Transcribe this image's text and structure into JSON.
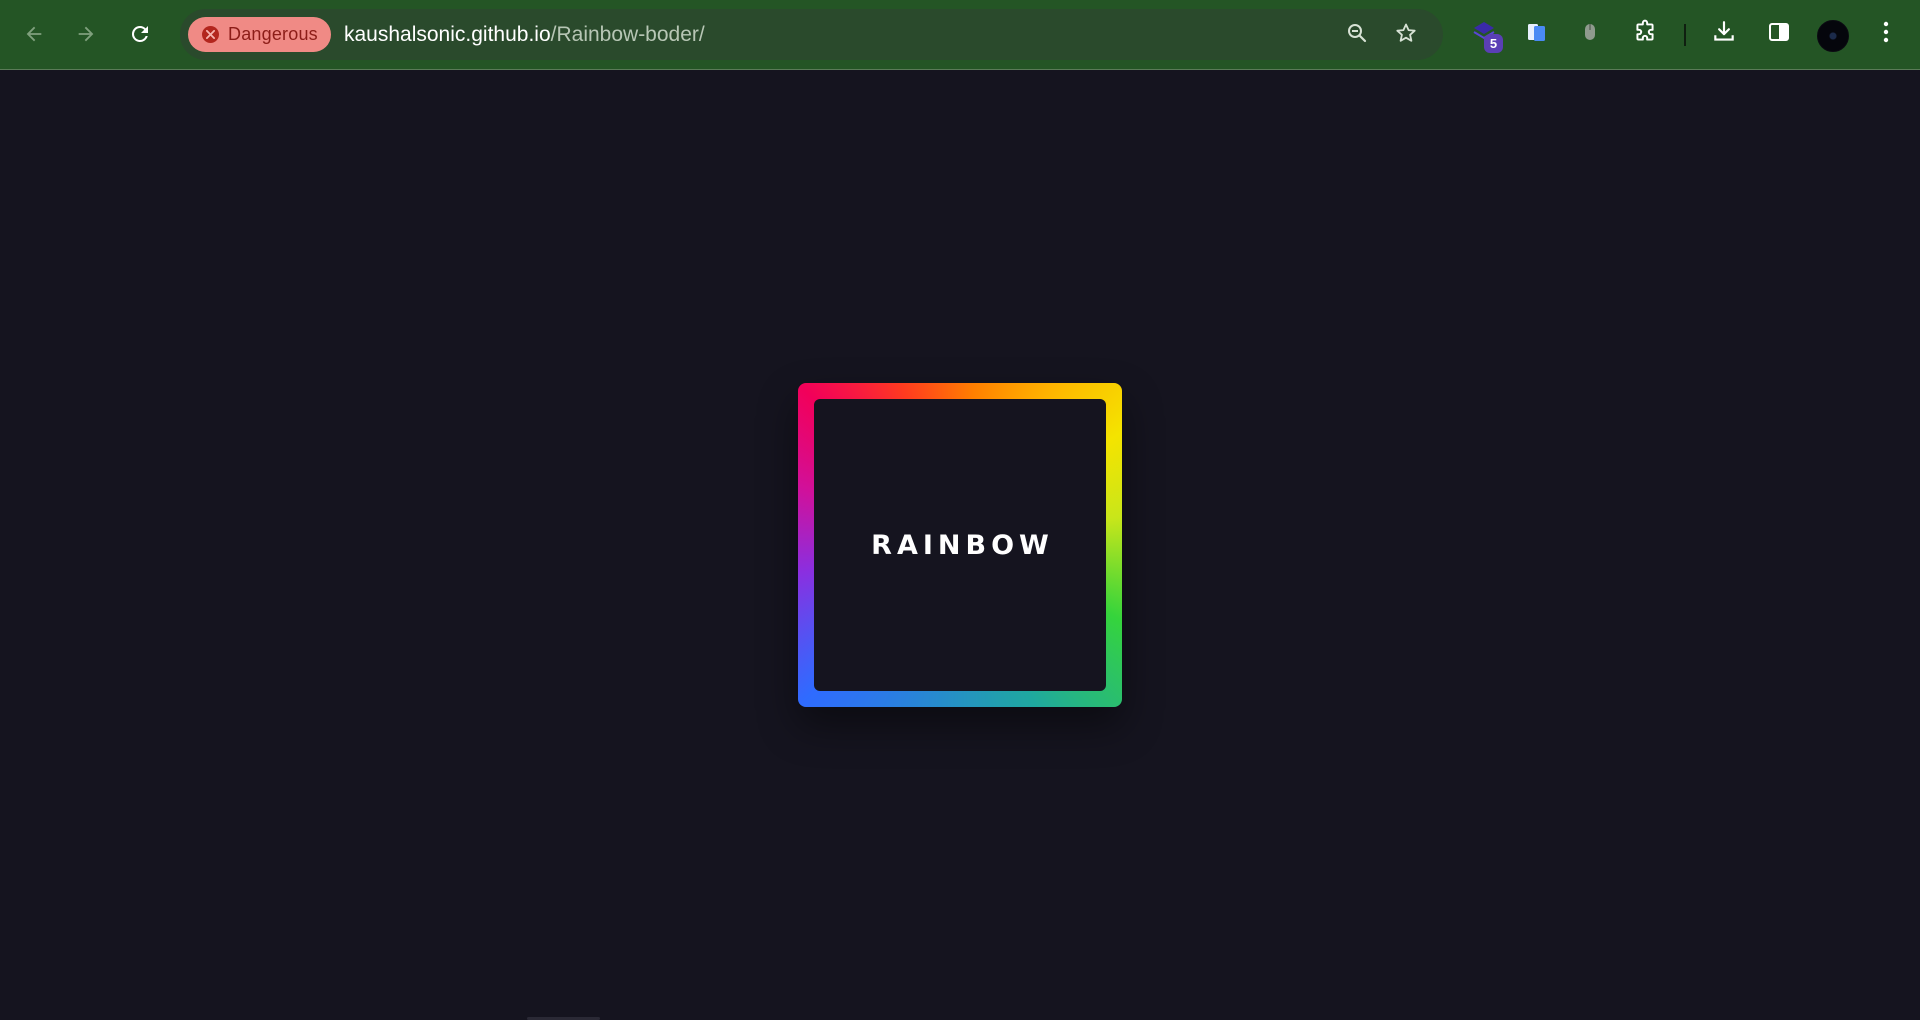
{
  "browser": {
    "nav": {
      "back_icon": "arrow-left-icon",
      "forward_icon": "arrow-right-icon",
      "reload_icon": "reload-icon"
    },
    "omnibox": {
      "security_label": "Dangerous",
      "security_icon": "error-circle-icon",
      "url_host": "kaushalsonic.github.io",
      "url_path": "/Rainbow-boder/",
      "zoom_icon": "zoom-out-icon",
      "bookmark_icon": "star-icon"
    },
    "extensions": {
      "badge_count": "5",
      "items": [
        "layered-extension-icon",
        "docs-extension-icon",
        "mouse-extension-icon",
        "puzzle-extensions-icon"
      ]
    },
    "actions": [
      "download-icon",
      "side-panel-icon",
      "profile-avatar",
      "more-menu-icon"
    ]
  },
  "page": {
    "box_label": "RAINBOW",
    "background": "#15141f"
  },
  "colors": {
    "toolbar": "#245525",
    "danger_chip": "#f08a85",
    "danger_text": "#8c1d18"
  }
}
